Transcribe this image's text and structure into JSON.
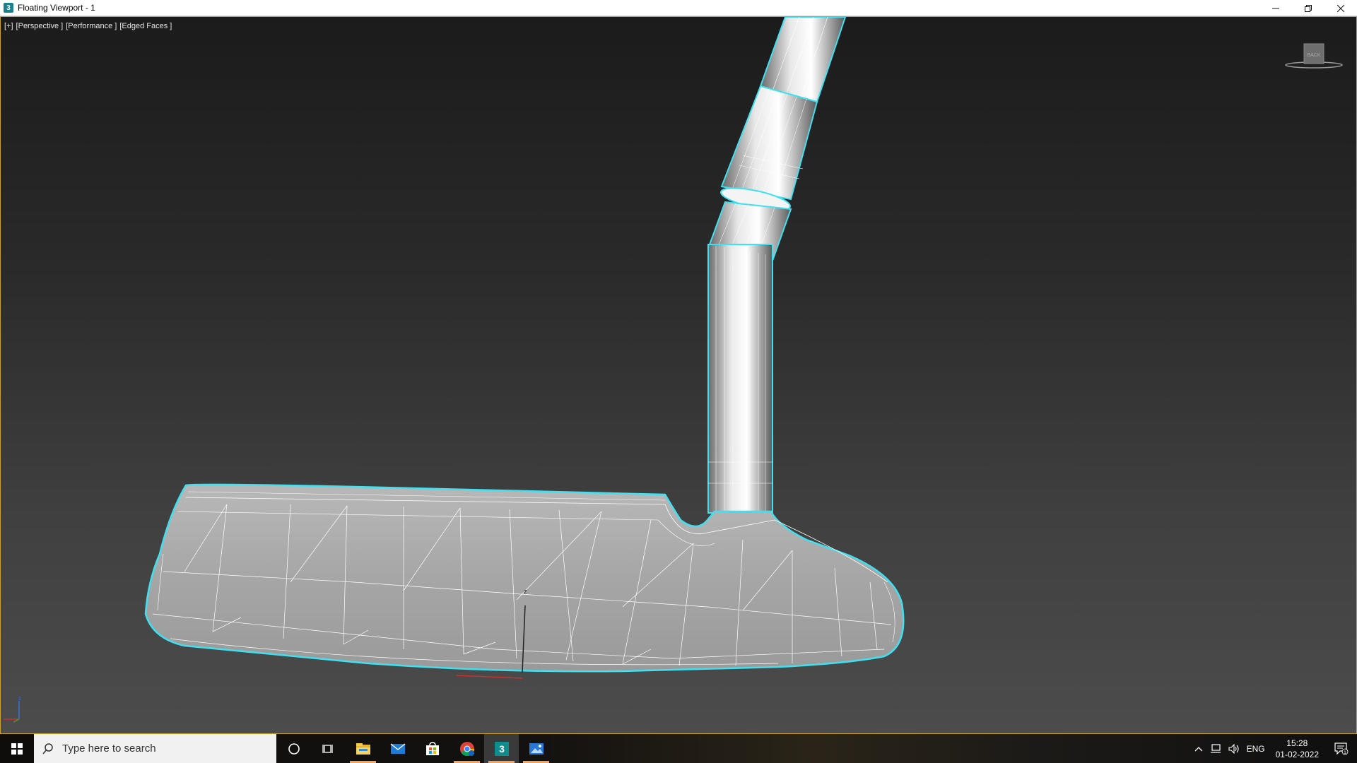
{
  "window": {
    "title": "Floating Viewport - 1",
    "controls": [
      "minimize-icon",
      "restore-icon",
      "close-icon"
    ]
  },
  "viewport": {
    "labels": [
      "[+]",
      "[Perspective ]",
      "[Performance ]",
      "[Edged Faces ]"
    ],
    "viewcube_label": "BACK",
    "colors": {
      "border": "#c9a227",
      "selection_outline": "#40e0f0",
      "wire": "#ffffff",
      "mesh_fill": "#a8a8a8"
    }
  },
  "taskbar": {
    "search_placeholder": "Type here to search",
    "apps": [
      "cortana-icon",
      "task-view-icon",
      "file-explorer-icon",
      "mail-icon",
      "store-icon",
      "chrome-icon",
      "3dsmax-icon",
      "photos-icon"
    ],
    "tray": {
      "language": "ENG",
      "time": "15:28",
      "date": "01-02-2022",
      "notification_count": "1"
    }
  }
}
